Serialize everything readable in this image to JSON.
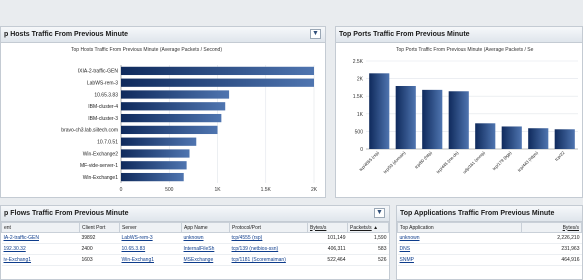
{
  "panels": {
    "hosts": {
      "title": "p Hosts Traffic From Previous Minute",
      "chart_title": "Top Hosts Traffic From Previous Minute (Average Packets / Second)"
    },
    "ports": {
      "title": "Top Ports Traffic From Previous Minute",
      "chart_title": "Top Ports Traffic From Previous Minute (Average Packets / Se"
    },
    "flows": {
      "title": "p Flows Traffic From Previous Minute",
      "columns": [
        "ent",
        "Client Port",
        "Server",
        "App Name",
        "Protocol/Port",
        "Bytes/s",
        "Packets/s"
      ],
      "rows": [
        [
          "IA-2-traffic-GEN",
          "39892",
          "LabWS-rem-3",
          "unknown",
          "tcp/4555 (rsp)",
          "101,149",
          "1,590"
        ],
        [
          "192.30.32",
          "2400",
          "10.65.3.83",
          "InternalFileSh",
          "tcp/139 (netbios-ssn)",
          "406,311",
          "583"
        ],
        [
          "iv-Exchang1",
          "1603",
          "Win-Exchang1",
          "MSExchange",
          "tcp/1181 (Scoremaiman)",
          "522,464",
          "526"
        ]
      ]
    },
    "apps": {
      "title": "Top Applications Traffic From Previous Minute",
      "columns": [
        "Top Application",
        "Bytes/s"
      ],
      "rows": [
        [
          "unknown",
          "2,226,210"
        ],
        [
          "DNS",
          "231,963"
        ],
        [
          "SNMP",
          "464,916"
        ]
      ]
    }
  },
  "collapse_glyph": "▼",
  "sort_glyph": "▲",
  "chart_data": [
    {
      "type": "bar",
      "orientation": "horizontal",
      "title": "Top Hosts Traffic From Previous Minute (Average Packets / Second)",
      "categories": [
        "IXIA-2-traffic-GEN",
        "LabWS-rem-3",
        "10.65.3.83",
        "IBM-cluster-4",
        "IBM-cluster-3",
        "bravo-ch3.lab.siitech.com",
        "10.7.0.51",
        "Win-Exchange2",
        "MF-vide-server-1",
        "Win-Exchange1"
      ],
      "values": [
        2200,
        2170,
        1120,
        1080,
        1040,
        1000,
        780,
        710,
        680,
        650
      ],
      "xlim": [
        0,
        2000
      ],
      "xticks": [
        "0",
        "500",
        "1K",
        "1.5K",
        "2K"
      ]
    },
    {
      "type": "bar",
      "title": "Top Ports Traffic From Previous Minute (Average Packets / Se",
      "categories": [
        "tcp/4555 (rsp)",
        "tcp/53 (domain)",
        "tcp/80 (http)",
        "tcp/445 (ms-ds)",
        "udp/161 (snmp)",
        "tcp/179 (bgp)",
        "tcp/443 (https)",
        "tcp/22"
      ],
      "values": [
        2150,
        1790,
        1680,
        1640,
        730,
        640,
        590,
        560
      ],
      "ylim": [
        0,
        2500
      ],
      "yticks": [
        "0",
        "500",
        "1K",
        "1.5K",
        "2K",
        "2.5K"
      ]
    }
  ]
}
